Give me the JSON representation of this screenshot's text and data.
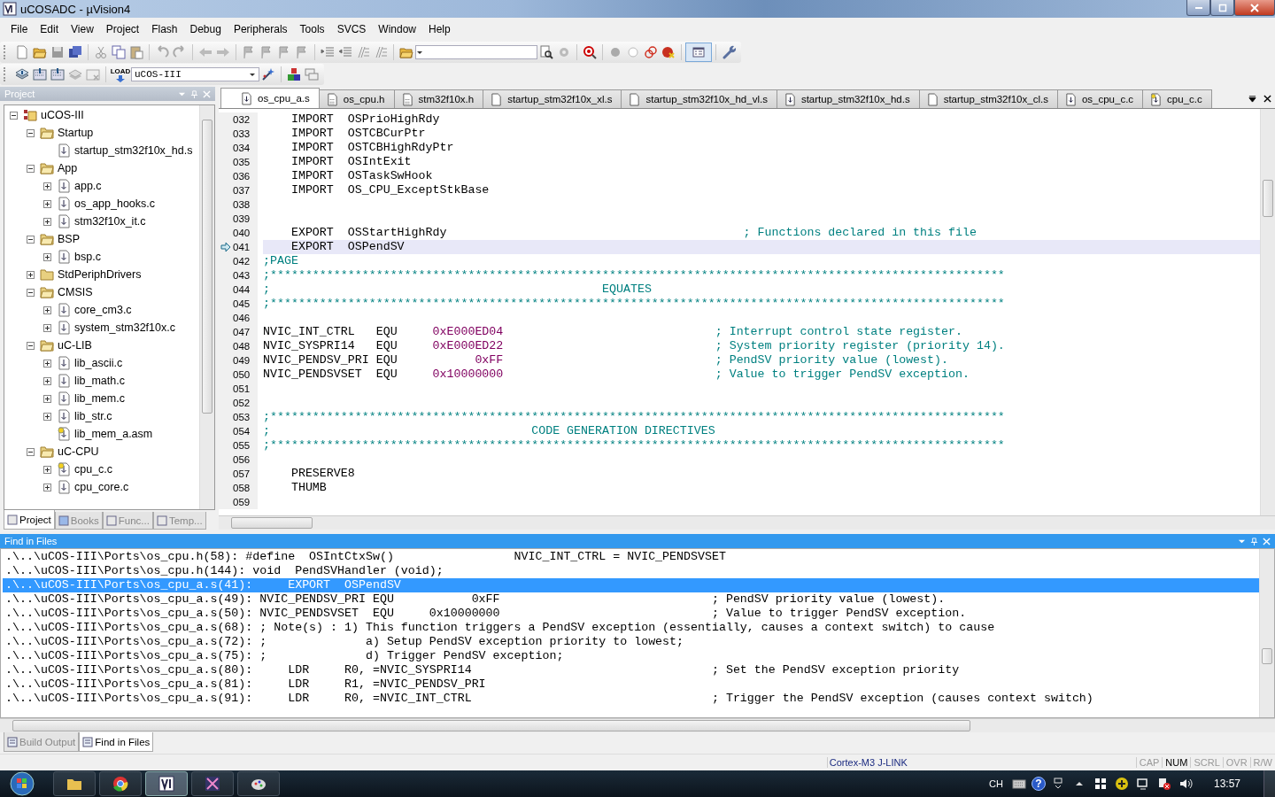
{
  "window": {
    "title": "uCOSADC  - µVision4"
  },
  "menu": [
    "File",
    "Edit",
    "View",
    "Project",
    "Flash",
    "Debug",
    "Peripherals",
    "Tools",
    "SVCS",
    "Window",
    "Help"
  ],
  "toolbar": {
    "load_icon_label": "LOAD",
    "target": "uCOS-III"
  },
  "project": {
    "title": "Project",
    "tree": [
      {
        "label": "uCOS-III",
        "kind": "root",
        "expanded": true,
        "children": [
          {
            "label": "Startup",
            "kind": "folder",
            "expanded": true,
            "children": [
              {
                "label": "startup_stm32f10x_hd.s",
                "kind": "file"
              }
            ]
          },
          {
            "label": "App",
            "kind": "folder",
            "expanded": true,
            "children": [
              {
                "label": "app.c",
                "kind": "file",
                "expanded": false
              },
              {
                "label": "os_app_hooks.c",
                "kind": "file",
                "expanded": false
              },
              {
                "label": "stm32f10x_it.c",
                "kind": "file",
                "expanded": false
              }
            ]
          },
          {
            "label": "BSP",
            "kind": "folder",
            "expanded": true,
            "children": [
              {
                "label": "bsp.c",
                "kind": "file",
                "expanded": false
              }
            ]
          },
          {
            "label": "StdPeriphDrivers",
            "kind": "folder",
            "expanded": false
          },
          {
            "label": "CMSIS",
            "kind": "folder",
            "expanded": true,
            "children": [
              {
                "label": "core_cm3.c",
                "kind": "file",
                "expanded": false
              },
              {
                "label": "system_stm32f10x.c",
                "kind": "file",
                "expanded": false
              }
            ]
          },
          {
            "label": "uC-LIB",
            "kind": "folder",
            "expanded": true,
            "children": [
              {
                "label": "lib_ascii.c",
                "kind": "file",
                "expanded": false
              },
              {
                "label": "lib_math.c",
                "kind": "file",
                "expanded": false
              },
              {
                "label": "lib_mem.c",
                "kind": "file",
                "expanded": false
              },
              {
                "label": "lib_str.c",
                "kind": "file",
                "expanded": false
              },
              {
                "label": "lib_mem_a.asm",
                "kind": "file-options"
              }
            ]
          },
          {
            "label": "uC-CPU",
            "kind": "folder",
            "expanded": true,
            "children": [
              {
                "label": "cpu_c.c",
                "kind": "file-options",
                "expanded": false
              },
              {
                "label": "cpu_core.c",
                "kind": "file",
                "expanded": false
              }
            ]
          }
        ]
      }
    ],
    "tabs": [
      {
        "label": "Project",
        "selected": true
      },
      {
        "label": "Books",
        "selected": false
      },
      {
        "label": "Func...",
        "selected": false
      },
      {
        "label": "Temp...",
        "selected": false
      }
    ]
  },
  "editor": {
    "tabs": [
      {
        "label": "os_cpu_a.s",
        "kind": "source",
        "selected": true
      },
      {
        "label": "os_cpu.h",
        "kind": "header",
        "selected": false
      },
      {
        "label": "stm32f10x.h",
        "kind": "header",
        "selected": false
      },
      {
        "label": "startup_stm32f10x_xl.s",
        "kind": "plain",
        "selected": false
      },
      {
        "label": "startup_stm32f10x_hd_vl.s",
        "kind": "plain",
        "selected": false
      },
      {
        "label": "startup_stm32f10x_hd.s",
        "kind": "source",
        "selected": false
      },
      {
        "label": "startup_stm32f10x_cl.s",
        "kind": "plain",
        "selected": false
      },
      {
        "label": "os_cpu_c.c",
        "kind": "source",
        "selected": false
      },
      {
        "label": "cpu_c.c",
        "kind": "options",
        "selected": false
      }
    ],
    "lines": [
      {
        "number": "032",
        "current": false,
        "segments": [
          {
            "text": "    IMPORT  OSPrioHighRdy",
            "kind": "plain"
          }
        ]
      },
      {
        "number": "033",
        "current": false,
        "segments": [
          {
            "text": "    IMPORT  OSTCBCurPtr",
            "kind": "plain"
          }
        ]
      },
      {
        "number": "034",
        "current": false,
        "segments": [
          {
            "text": "    IMPORT  OSTCBHighRdyPtr",
            "kind": "plain"
          }
        ]
      },
      {
        "number": "035",
        "current": false,
        "segments": [
          {
            "text": "    IMPORT  OSIntExit",
            "kind": "plain"
          }
        ]
      },
      {
        "number": "036",
        "current": false,
        "segments": [
          {
            "text": "    IMPORT  OSTaskSwHook",
            "kind": "plain"
          }
        ]
      },
      {
        "number": "037",
        "current": false,
        "segments": [
          {
            "text": "    IMPORT  OS_CPU_ExceptStkBase",
            "kind": "plain"
          }
        ]
      },
      {
        "number": "038",
        "current": false
      },
      {
        "number": "039",
        "current": false
      },
      {
        "number": "040",
        "current": false,
        "segments": [
          {
            "text": "    EXPORT  OSStartHighRdy",
            "kind": "plain"
          },
          {
            "text": "                                          ; Functions declared in this file",
            "kind": "comment"
          }
        ]
      },
      {
        "number": "041",
        "current": true,
        "segments": [
          {
            "text": "    EXPORT  OSPendSV",
            "kind": "plain"
          }
        ]
      },
      {
        "number": "042",
        "current": false,
        "segments": [
          {
            "text": ";PAGE",
            "kind": "comment"
          }
        ]
      },
      {
        "number": "043",
        "current": false,
        "segments": [
          {
            "text": ";********************************************************************************************************",
            "kind": "comment"
          }
        ]
      },
      {
        "number": "044",
        "current": false,
        "segments": [
          {
            "text": ";                                               EQUATES",
            "kind": "comment"
          }
        ]
      },
      {
        "number": "045",
        "current": false,
        "segments": [
          {
            "text": ";********************************************************************************************************",
            "kind": "comment"
          }
        ]
      },
      {
        "number": "046",
        "current": false
      },
      {
        "number": "047",
        "current": false,
        "segments": [
          {
            "text": "NVIC_INT_CTRL   EQU     ",
            "kind": "plain"
          },
          {
            "text": "0xE000ED04",
            "kind": "number"
          },
          {
            "text": "                              ; Interrupt control state register.",
            "kind": "comment"
          }
        ]
      },
      {
        "number": "048",
        "current": false,
        "segments": [
          {
            "text": "NVIC_SYSPRI14   EQU     ",
            "kind": "plain"
          },
          {
            "text": "0xE000ED22",
            "kind": "number"
          },
          {
            "text": "                              ; System priority register (priority 14).",
            "kind": "comment"
          }
        ]
      },
      {
        "number": "049",
        "current": false,
        "segments": [
          {
            "text": "NVIC_PENDSV_PRI EQU           ",
            "kind": "plain"
          },
          {
            "text": "0xFF",
            "kind": "number"
          },
          {
            "text": "                              ; PendSV priority value (lowest).",
            "kind": "comment"
          }
        ]
      },
      {
        "number": "050",
        "current": false,
        "segments": [
          {
            "text": "NVIC_PENDSVSET  EQU     ",
            "kind": "plain"
          },
          {
            "text": "0x10000000",
            "kind": "number"
          },
          {
            "text": "                              ; Value to trigger PendSV exception.",
            "kind": "comment"
          }
        ]
      },
      {
        "number": "051",
        "current": false
      },
      {
        "number": "052",
        "current": false
      },
      {
        "number": "053",
        "current": false,
        "segments": [
          {
            "text": ";********************************************************************************************************",
            "kind": "comment"
          }
        ]
      },
      {
        "number": "054",
        "current": false,
        "segments": [
          {
            "text": ";                                     CODE GENERATION DIRECTIVES",
            "kind": "comment"
          }
        ]
      },
      {
        "number": "055",
        "current": false,
        "segments": [
          {
            "text": ";********************************************************************************************************",
            "kind": "comment"
          }
        ]
      },
      {
        "number": "056",
        "current": false
      },
      {
        "number": "057",
        "current": false,
        "segments": [
          {
            "text": "    PRESERVE8",
            "kind": "plain"
          }
        ]
      },
      {
        "number": "058",
        "current": false,
        "segments": [
          {
            "text": "    THUMB",
            "kind": "plain"
          }
        ]
      },
      {
        "number": "059",
        "current": false
      }
    ]
  },
  "find_in_files": {
    "title": "Find in Files",
    "results": [
      {
        "text": ".\\..\\uCOS-III\\Ports\\os_cpu.h(58): #define  OSIntCtxSw()                 NVIC_INT_CTRL = NVIC_PENDSVSET",
        "selected": false
      },
      {
        "text": ".\\..\\uCOS-III\\Ports\\os_cpu.h(144): void  PendSVHandler (void);",
        "selected": false
      },
      {
        "text": ".\\..\\uCOS-III\\Ports\\os_cpu_a.s(41):     EXPORT  OSPendSV",
        "selected": true
      },
      {
        "text": ".\\..\\uCOS-III\\Ports\\os_cpu_a.s(49): NVIC_PENDSV_PRI EQU           0xFF                              ; PendSV priority value (lowest).",
        "selected": false
      },
      {
        "text": ".\\..\\uCOS-III\\Ports\\os_cpu_a.s(50): NVIC_PENDSVSET  EQU     0x10000000                              ; Value to trigger PendSV exception.",
        "selected": false
      },
      {
        "text": ".\\..\\uCOS-III\\Ports\\os_cpu_a.s(68): ; Note(s) : 1) This function triggers a PendSV exception (essentially, causes a context switch) to cause",
        "selected": false
      },
      {
        "text": ".\\..\\uCOS-III\\Ports\\os_cpu_a.s(72): ;              a) Setup PendSV exception priority to lowest;",
        "selected": false
      },
      {
        "text": ".\\..\\uCOS-III\\Ports\\os_cpu_a.s(75): ;              d) Trigger PendSV exception;",
        "selected": false
      },
      {
        "text": ".\\..\\uCOS-III\\Ports\\os_cpu_a.s(80):     LDR     R0, =NVIC_SYSPRI14                                  ; Set the PendSV exception priority",
        "selected": false
      },
      {
        "text": ".\\..\\uCOS-III\\Ports\\os_cpu_a.s(81):     LDR     R1, =NVIC_PENDSV_PRI",
        "selected": false
      },
      {
        "text": ".\\..\\uCOS-III\\Ports\\os_cpu_a.s(91):     LDR     R0, =NVIC_INT_CTRL                                  ; Trigger the PendSV exception (causes context switch)",
        "selected": false
      }
    ]
  },
  "output_tabs": [
    {
      "label": "Build Output",
      "selected": false
    },
    {
      "label": "Find in Files",
      "selected": true
    }
  ],
  "status_bar": {
    "target": "Cortex-M3 J-LINK",
    "indicators": [
      {
        "label": "CAP",
        "on": false
      },
      {
        "label": "NUM",
        "on": true
      },
      {
        "label": "SCRL",
        "on": false
      },
      {
        "label": "OVR",
        "on": false
      },
      {
        "label": "R/W",
        "on": false
      }
    ]
  },
  "taskbar": {
    "apps": [
      {
        "kind": "folder",
        "selected": false
      },
      {
        "kind": "browser",
        "selected": false
      },
      {
        "kind": "uvision",
        "selected": true
      },
      {
        "kind": "tool",
        "selected": false
      },
      {
        "kind": "paint",
        "selected": false
      }
    ],
    "language": "CH",
    "help_glyph": "?",
    "time": "13:57"
  }
}
